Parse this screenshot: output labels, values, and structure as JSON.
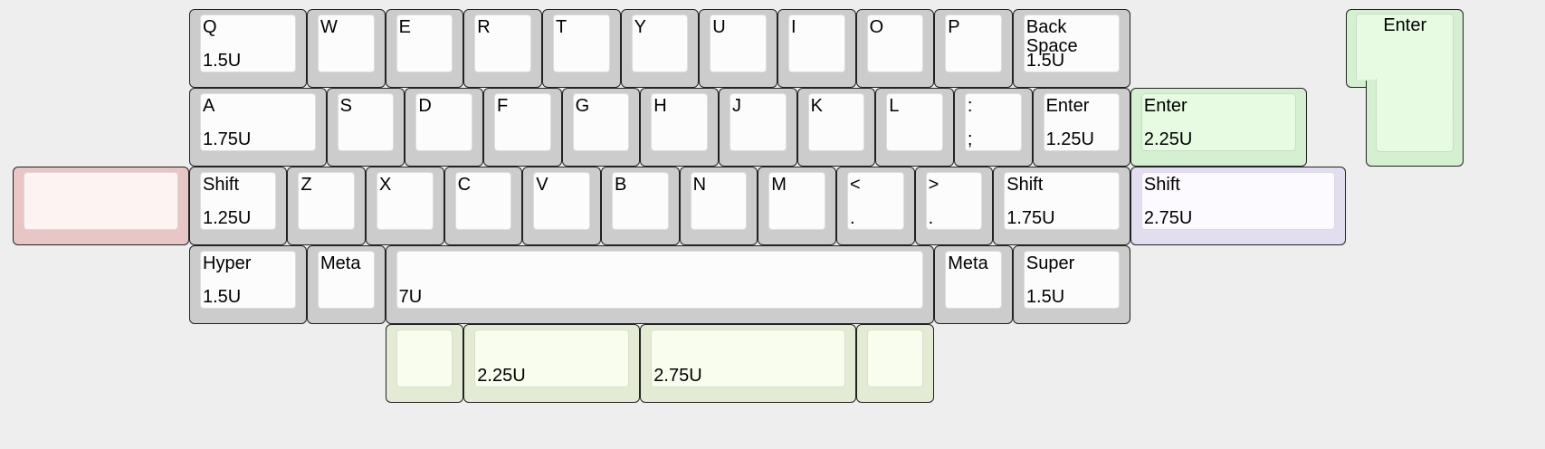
{
  "colors": {
    "default": {
      "outer": "#cccccc",
      "cap": "#fcfcfc"
    },
    "green": {
      "outer": "#d5f0d1",
      "cap": "#e6fbe2"
    },
    "red": {
      "outer": "#e9c6c6",
      "cap": "#fdf3f3"
    },
    "lavender": {
      "outer": "#e3ddf0",
      "cap": "#fcfaff"
    },
    "lime": {
      "outer": "#e4ebd4",
      "cap": "#f8fdee"
    },
    "border": "#222222"
  },
  "keys": [
    {
      "id": "q",
      "row": 0,
      "x": 0,
      "w": 1.5,
      "top": "Q",
      "bottom": "1.5U"
    },
    {
      "id": "w",
      "row": 0,
      "x": 1.5,
      "w": 1,
      "top": "W"
    },
    {
      "id": "e",
      "row": 0,
      "x": 2.5,
      "w": 1,
      "top": "E"
    },
    {
      "id": "r",
      "row": 0,
      "x": 3.5,
      "w": 1,
      "top": "R"
    },
    {
      "id": "t",
      "row": 0,
      "x": 4.5,
      "w": 1,
      "top": "T"
    },
    {
      "id": "y",
      "row": 0,
      "x": 5.5,
      "w": 1,
      "top": "Y"
    },
    {
      "id": "u",
      "row": 0,
      "x": 6.5,
      "w": 1,
      "top": "U"
    },
    {
      "id": "i",
      "row": 0,
      "x": 7.5,
      "w": 1,
      "top": "I"
    },
    {
      "id": "o",
      "row": 0,
      "x": 8.5,
      "w": 1,
      "top": "O"
    },
    {
      "id": "p",
      "row": 0,
      "x": 9.5,
      "w": 1,
      "top": "P"
    },
    {
      "id": "backspace",
      "row": 0,
      "x": 10.5,
      "w": 1.5,
      "top": "Back\nSpace",
      "bottom": "1.5U"
    },
    {
      "id": "a",
      "row": 1,
      "x": 0,
      "w": 1.75,
      "top": "A",
      "bottom": "1.75U"
    },
    {
      "id": "s",
      "row": 1,
      "x": 1.75,
      "w": 1,
      "top": "S"
    },
    {
      "id": "d",
      "row": 1,
      "x": 2.75,
      "w": 1,
      "top": "D"
    },
    {
      "id": "f",
      "row": 1,
      "x": 3.75,
      "w": 1,
      "top": "F"
    },
    {
      "id": "g",
      "row": 1,
      "x": 4.75,
      "w": 1,
      "top": "G"
    },
    {
      "id": "h",
      "row": 1,
      "x": 5.75,
      "w": 1,
      "top": "H"
    },
    {
      "id": "j",
      "row": 1,
      "x": 6.75,
      "w": 1,
      "top": "J"
    },
    {
      "id": "k",
      "row": 1,
      "x": 7.75,
      "w": 1,
      "top": "K"
    },
    {
      "id": "l",
      "row": 1,
      "x": 8.75,
      "w": 1,
      "top": "L"
    },
    {
      "id": "colon",
      "row": 1,
      "x": 9.75,
      "w": 1,
      "top": ":",
      "bottom": ";"
    },
    {
      "id": "enter-125",
      "row": 1,
      "x": 10.75,
      "w": 1.25,
      "top": "Enter",
      "bottom": "1.25U"
    },
    {
      "id": "enter-225",
      "row": 1,
      "x": 12,
      "w": 2.25,
      "top": "Enter",
      "bottom": "2.25U",
      "color": "green"
    },
    {
      "id": "blank-red",
      "row": 2,
      "x": -2.25,
      "w": 2.25,
      "color": "red"
    },
    {
      "id": "shift-left",
      "row": 2,
      "x": 0,
      "w": 1.25,
      "top": "Shift",
      "bottom": "1.25U"
    },
    {
      "id": "z",
      "row": 2,
      "x": 1.25,
      "w": 1,
      "top": "Z"
    },
    {
      "id": "x",
      "row": 2,
      "x": 2.25,
      "w": 1,
      "top": "X"
    },
    {
      "id": "c",
      "row": 2,
      "x": 3.25,
      "w": 1,
      "top": "C"
    },
    {
      "id": "v",
      "row": 2,
      "x": 4.25,
      "w": 1,
      "top": "V"
    },
    {
      "id": "b",
      "row": 2,
      "x": 5.25,
      "w": 1,
      "top": "B"
    },
    {
      "id": "n",
      "row": 2,
      "x": 6.25,
      "w": 1,
      "top": "N"
    },
    {
      "id": "m",
      "row": 2,
      "x": 7.25,
      "w": 1,
      "top": "M"
    },
    {
      "id": "comma",
      "row": 2,
      "x": 8.25,
      "w": 1,
      "top": "<",
      "bottom": "."
    },
    {
      "id": "period",
      "row": 2,
      "x": 9.25,
      "w": 1,
      "top": ">",
      "bottom": "."
    },
    {
      "id": "shift-right",
      "row": 2,
      "x": 10.25,
      "w": 1.75,
      "top": "Shift",
      "bottom": "1.75U"
    },
    {
      "id": "shift-275",
      "row": 2,
      "x": 12,
      "w": 2.75,
      "top": "Shift",
      "bottom": "2.75U",
      "color": "lavender"
    },
    {
      "id": "hyper",
      "row": 3,
      "x": 0,
      "w": 1.5,
      "top": "Hyper",
      "bottom": "1.5U"
    },
    {
      "id": "meta-left",
      "row": 3,
      "x": 1.5,
      "w": 1,
      "top": "Meta"
    },
    {
      "id": "space-7u",
      "row": 3,
      "x": 2.5,
      "w": 7,
      "bottom": "7U"
    },
    {
      "id": "meta-right",
      "row": 3,
      "x": 9.5,
      "w": 1,
      "top": "Meta"
    },
    {
      "id": "super",
      "row": 3,
      "x": 10.5,
      "w": 1.5,
      "top": "Super",
      "bottom": "1.5U"
    },
    {
      "id": "blank-lime-1",
      "row": 4,
      "x": 2.5,
      "w": 1,
      "color": "lime"
    },
    {
      "id": "space-225",
      "row": 4,
      "x": 3.5,
      "w": 2.25,
      "bottom": "2.25U",
      "color": "lime"
    },
    {
      "id": "space-275",
      "row": 4,
      "x": 5.75,
      "w": 2.75,
      "bottom": "2.75U",
      "color": "lime"
    },
    {
      "id": "blank-lime-2",
      "row": 4,
      "x": 8.5,
      "w": 1,
      "color": "lime"
    }
  ],
  "iso_enter": {
    "label": "Enter",
    "x": 14.75,
    "row": 0,
    "color": "green"
  }
}
